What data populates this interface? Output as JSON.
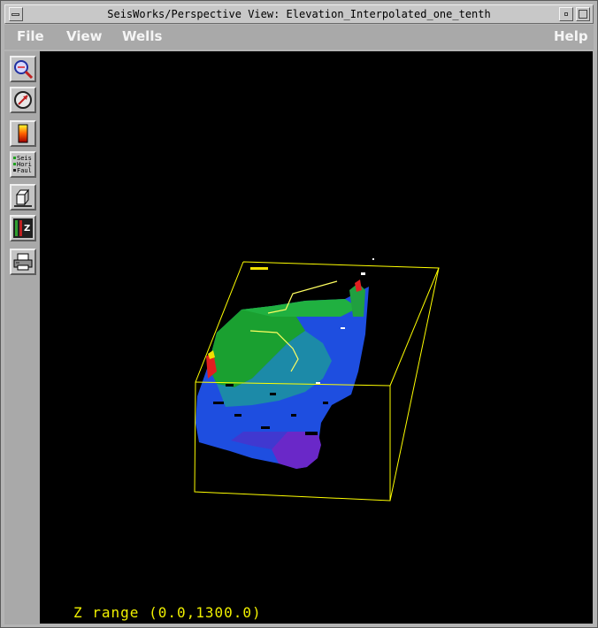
{
  "window": {
    "title": "SeisWorks/Perspective View: Elevation_Interpolated_one_tenth"
  },
  "menu": {
    "file": "File",
    "view": "View",
    "wells": "Wells",
    "help": "Help"
  },
  "toolbar": {
    "tools": [
      {
        "name": "zoom-tool",
        "icon": "magnifier-icon"
      },
      {
        "name": "rotate-tool",
        "icon": "compass-icon"
      },
      {
        "name": "colorbar-tool",
        "icon": "colorbar-icon"
      },
      {
        "name": "display-toggle-tool",
        "icon": "seis-hori-faul-icon"
      },
      {
        "name": "cube-tool",
        "icon": "cube-icon"
      },
      {
        "name": "z-scale-tool",
        "icon": "z-scale-icon"
      },
      {
        "name": "print-tool",
        "icon": "printer-icon"
      }
    ],
    "display_toggle_labels": [
      "Seis",
      "Hori",
      "Faul"
    ],
    "z_label": "Z"
  },
  "viewport": {
    "z_range_text": "Z range (0.0,1300.0)",
    "bounding_box_color": "#ffff00",
    "surface_colors": [
      "#ff2020",
      "#f0e000",
      "#20c020",
      "#1a9aa0",
      "#1a6ae0",
      "#2040d0",
      "#5a2ad0",
      "#7a20c0"
    ]
  }
}
